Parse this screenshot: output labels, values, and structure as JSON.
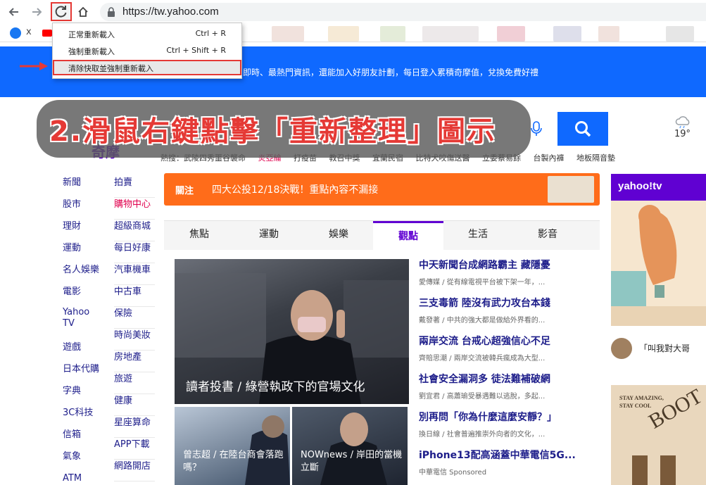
{
  "browser": {
    "url": "https://tw.yahoo.com",
    "back_icon": "arrow-left-icon",
    "forward_icon": "arrow-right-icon",
    "reload_icon": "reload-icon",
    "home_icon": "home-icon"
  },
  "bookmarks": {
    "first_label": "x"
  },
  "context_menu": {
    "items": [
      {
        "label": "正常重新載入",
        "shortcut": "Ctrl + R"
      },
      {
        "label": "強制重新載入",
        "shortcut": "Ctrl + Shift + R"
      },
      {
        "label": "清除快取並強制重新載入",
        "shortcut": ""
      }
    ]
  },
  "banner": {
    "text": "即時、最熱門資訊，還能加入好朋友計劃，每日登入累積奇摩值，兌換免費好禮"
  },
  "callout": {
    "text": "2.滑鼠右鍵點擊「重新整理」圖示"
  },
  "logo_tail": "奇摩",
  "weather": "19°",
  "trends": [
    "熱搜：武陵四秀噩谷襲命",
    "炎亞綸",
    "打疫苗",
    "教召中獎",
    "宜蘭民宿",
    "比特犬咬傷送醫",
    "立委蔡易餘",
    "台製內褲",
    "地板隔音墊"
  ],
  "left_menu": {
    "col1": [
      "新聞",
      "股市",
      "理財",
      "運動",
      "名人娛樂",
      "電影",
      "Yahoo TV",
      "遊戲",
      "日本代購",
      "字典",
      "3C科技",
      "信箱",
      "氣象",
      "ATM"
    ],
    "col2": [
      "拍賣",
      "購物中心",
      "超級商城",
      "每日好康",
      "汽車機車",
      "中古車",
      "保險",
      "時尚美妝",
      "房地產",
      "旅遊",
      "健康",
      "星座算命",
      "APP下載",
      "網路開店"
    ]
  },
  "notice": {
    "label": "關注",
    "text": "四大公投12/18決戰！重點內容不漏接"
  },
  "tabs": [
    "焦點",
    "運動",
    "娛樂",
    "觀點",
    "生活",
    "影音"
  ],
  "hero": {
    "caption": "讀者投書 / 綠營執政下的官場文化"
  },
  "thumbs": [
    {
      "caption": "曾志超 / 在陸台商會落跑嗎？"
    },
    {
      "caption": "NOWnews / 岸田的當機立斷"
    }
  ],
  "news": [
    {
      "title": "中天新聞台成網路霸主 藏隱憂",
      "sub": "愛傳媒 / 從有線電視平台被下架一年，..."
    },
    {
      "title": "三支毒箭 陸沒有武力攻台本錢",
      "sub": "戴發著 / 中共的強大都是做給外界看的..."
    },
    {
      "title": "兩岸交流 台戒心超強信心不足",
      "sub": "齊賠思潮 / 兩岸交流被韓兵瘋成為大型..."
    },
    {
      "title": "社會安全漏洞多 徒法難補破網",
      "sub": "劉宜君 / 高蕭瑜受暴遇難以逃脫，多起..."
    },
    {
      "title": "別再問「你為什麼這麼安靜？」",
      "sub": "換日線 / 社會普遍推崇外向者的文化，..."
    },
    {
      "title": "iPhone13配高涵蓋中華電信5G...",
      "sub": "中華電信   Sponsored"
    }
  ],
  "rail": {
    "tv_logo": "yahoo!tv",
    "question": "「叫我對大哥",
    "ad_line1": "STAY AMAZING,",
    "ad_line2": "STAY COOL",
    "ad_big": "BOOT"
  },
  "colors": {
    "yahoo_purple": "#6001d2",
    "banner_blue": "#0f69ff",
    "notice_orange": "#ff6c1a",
    "highlight_red": "#e53935"
  }
}
